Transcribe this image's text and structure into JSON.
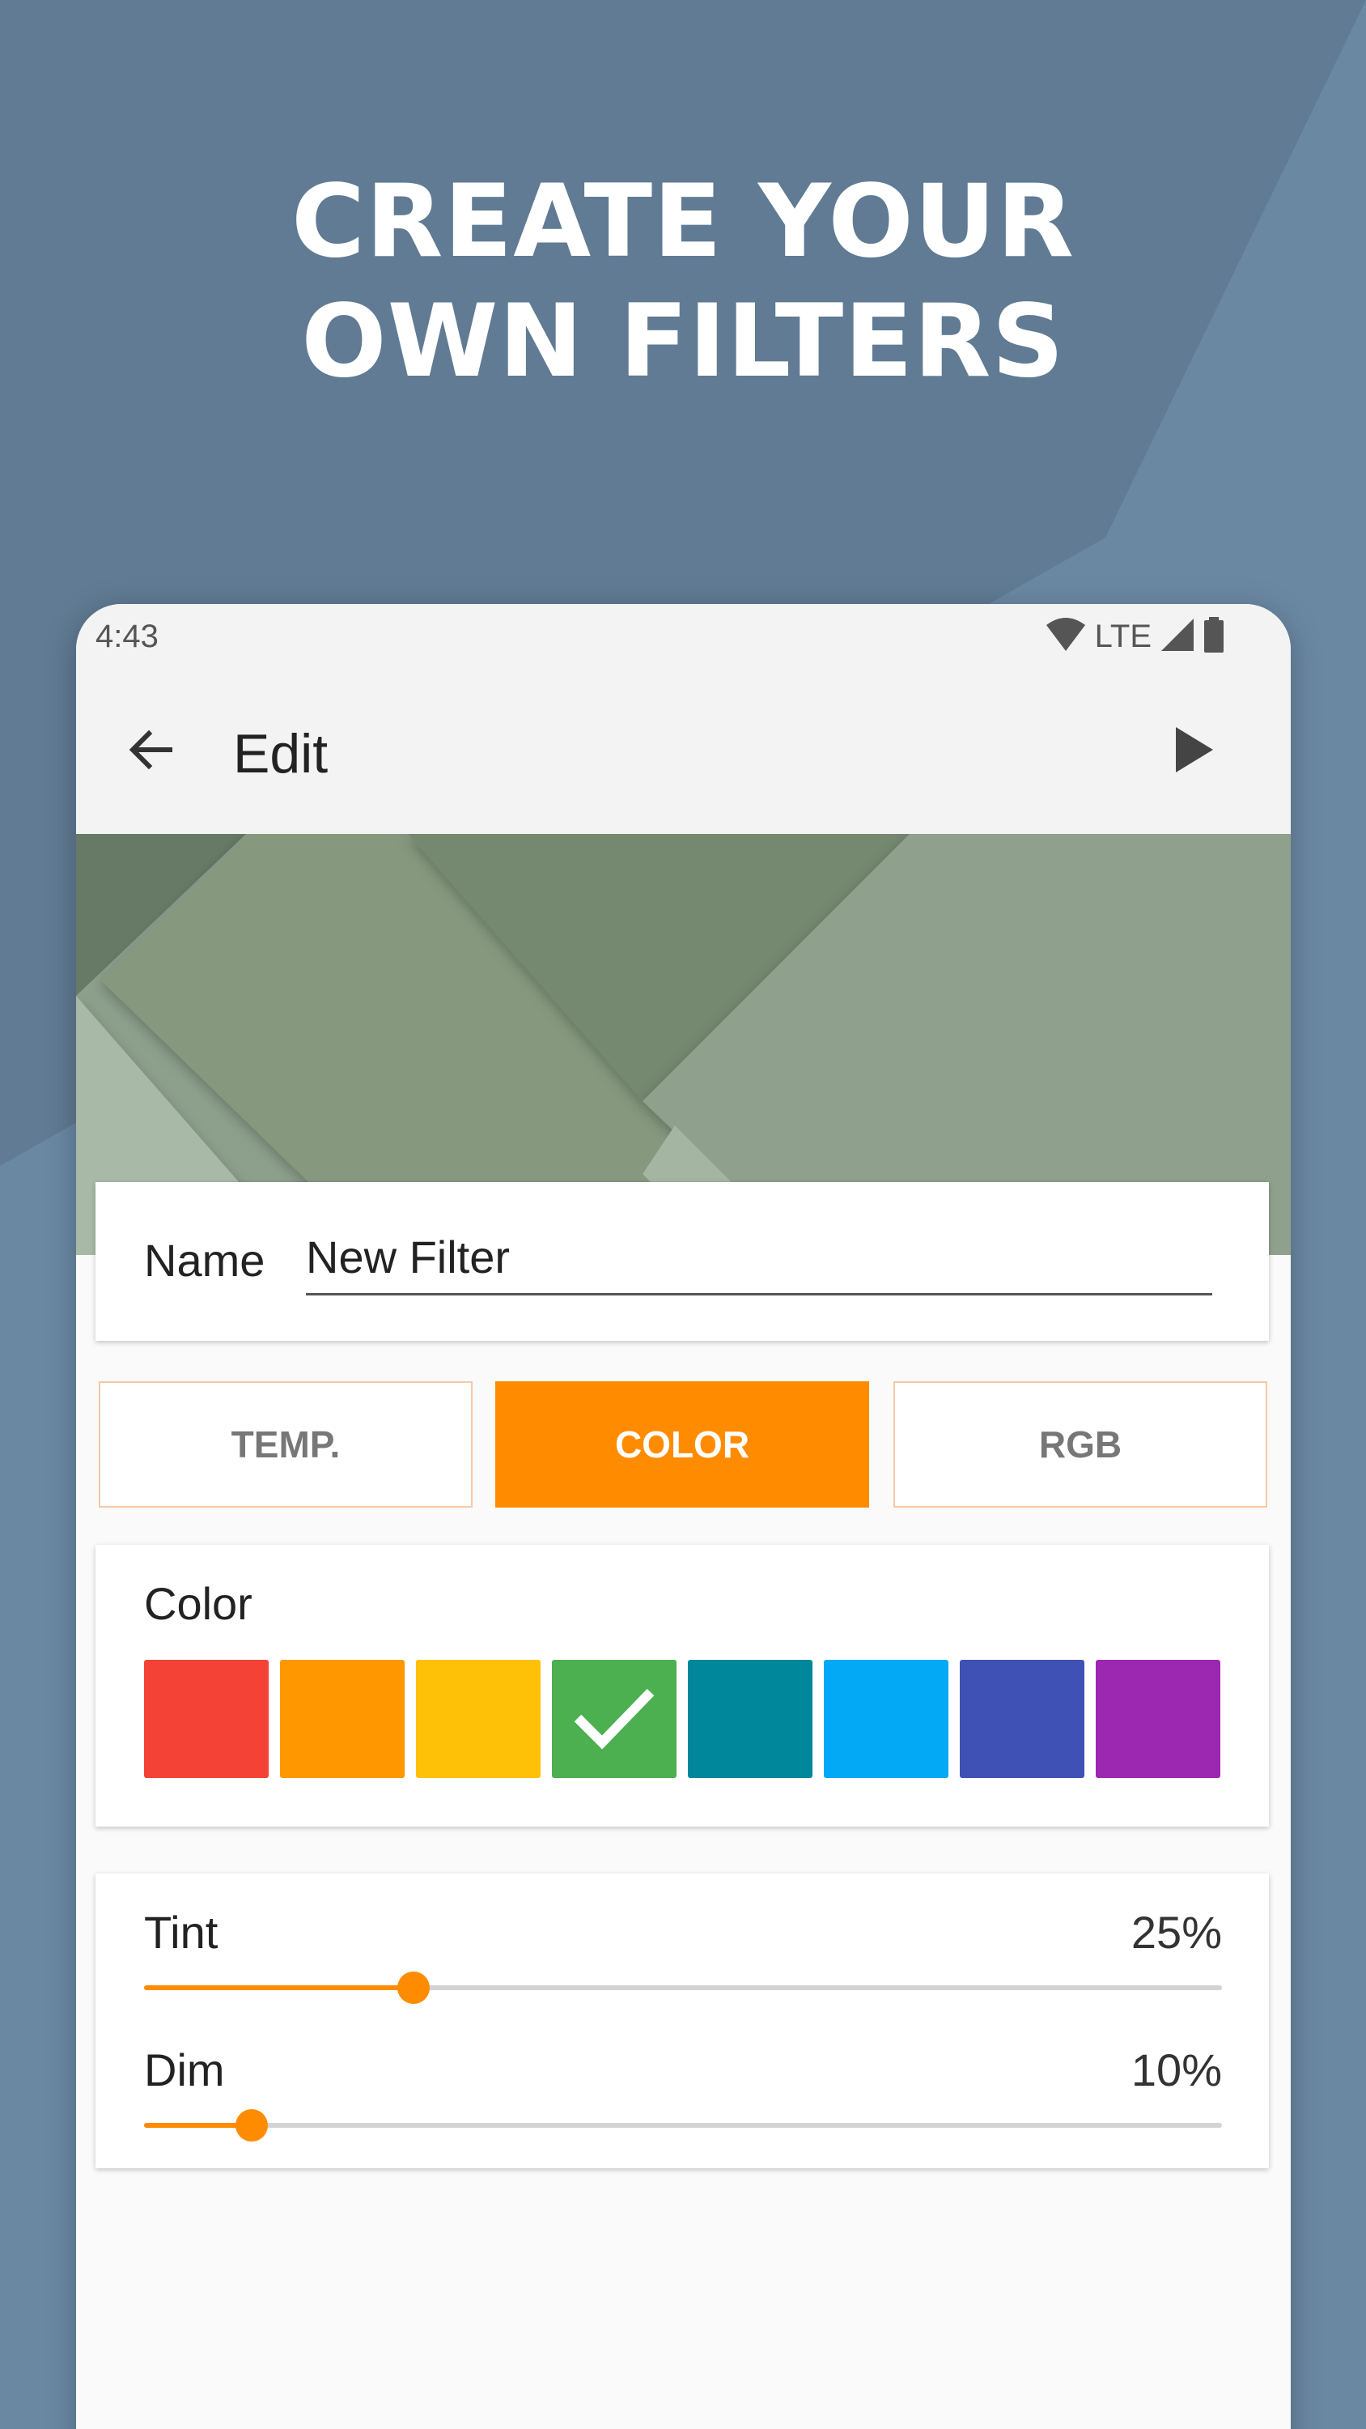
{
  "headline": {
    "line1": "CREATE YOUR",
    "line2": "OWN FILTERS"
  },
  "status_bar": {
    "time": "4:43",
    "network": "LTE",
    "icons": [
      "wifi-icon",
      "signal-icon",
      "battery-icon"
    ]
  },
  "toolbar": {
    "title": "Edit",
    "back_icon": "arrow-back-icon",
    "play_icon": "play-icon"
  },
  "name_field": {
    "label": "Name",
    "value": "New Filter"
  },
  "tabs": [
    {
      "label": "TEMP.",
      "selected": false
    },
    {
      "label": "COLOR",
      "selected": true
    },
    {
      "label": "RGB",
      "selected": false
    }
  ],
  "color_section": {
    "title": "Color",
    "swatches": [
      {
        "color": "#f44336",
        "selected": false
      },
      {
        "color": "#ff9800",
        "selected": false
      },
      {
        "color": "#ffc107",
        "selected": false
      },
      {
        "color": "#4caf50",
        "selected": true
      },
      {
        "color": "#00879b",
        "selected": false
      },
      {
        "color": "#03a9f4",
        "selected": false
      },
      {
        "color": "#3f51b5",
        "selected": false
      },
      {
        "color": "#9c27b0",
        "selected": false
      }
    ]
  },
  "sliders": [
    {
      "label": "Tint",
      "value_text": "25%",
      "value": 25
    },
    {
      "label": "Dim",
      "value_text": "10%",
      "value": 10
    }
  ],
  "colors": {
    "accent": "#ff8c00",
    "background": "#617b93",
    "surface": "#fafafa"
  }
}
